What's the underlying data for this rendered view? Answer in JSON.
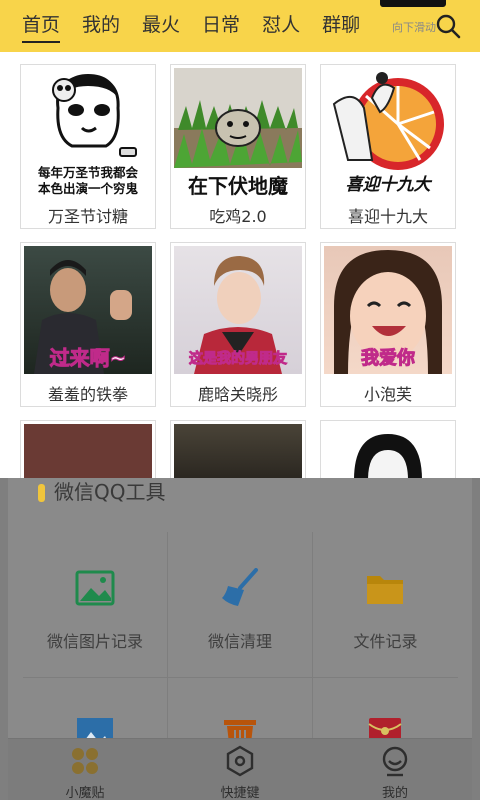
{
  "tabs": [
    {
      "label": "首页",
      "active": true
    },
    {
      "label": "我的",
      "active": false
    },
    {
      "label": "最火",
      "active": false
    },
    {
      "label": "日常",
      "active": false
    },
    {
      "label": "怼人",
      "active": false
    },
    {
      "label": "群聊",
      "active": false
    }
  ],
  "scroll_hint": "向下滑动",
  "search_icon": "search-icon",
  "stickers": [
    {
      "label": "万圣节讨糖",
      "caption": [
        "每年万圣节我都会",
        "本色出演一个穷鬼"
      ]
    },
    {
      "label": "吃鸡2.0",
      "caption": [
        "在下伏地魔"
      ]
    },
    {
      "label": "喜迎十九大",
      "caption": [
        "喜迎十九大"
      ]
    },
    {
      "label": "羞羞的铁拳",
      "caption": [
        "过来啊~"
      ]
    },
    {
      "label": "鹿晗关晓彤",
      "caption": [
        "这是我的男朋友"
      ]
    },
    {
      "label": "小泡芙",
      "caption": [
        "我爱你"
      ]
    }
  ],
  "tools_section": {
    "title": "微信QQ工具",
    "items": [
      {
        "label": "微信图片记录",
        "icon": "image-icon",
        "color": "#1f8a4c"
      },
      {
        "label": "微信清理",
        "icon": "broom-icon",
        "color": "#2c6ea8"
      },
      {
        "label": "文件记录",
        "icon": "folder-icon",
        "color": "#b8860b"
      },
      {
        "label": "",
        "icon": "picture-icon",
        "color": "#2c6ea8"
      },
      {
        "label": "",
        "icon": "trash-icon",
        "color": "#b8540b"
      },
      {
        "label": "",
        "icon": "red-packet-icon",
        "color": "#b0202c"
      }
    ]
  },
  "bottom_nav": [
    {
      "label": "小魔贴",
      "icon": "apps-icon",
      "active": true,
      "color": "#8a7030"
    },
    {
      "label": "快捷键",
      "icon": "hexagon-icon",
      "active": false,
      "color": "#2e2e2e"
    },
    {
      "label": "我的",
      "icon": "smiley-icon",
      "active": false,
      "color": "#2e2e2e"
    }
  ],
  "colors": {
    "accent": "#f8d44a"
  }
}
